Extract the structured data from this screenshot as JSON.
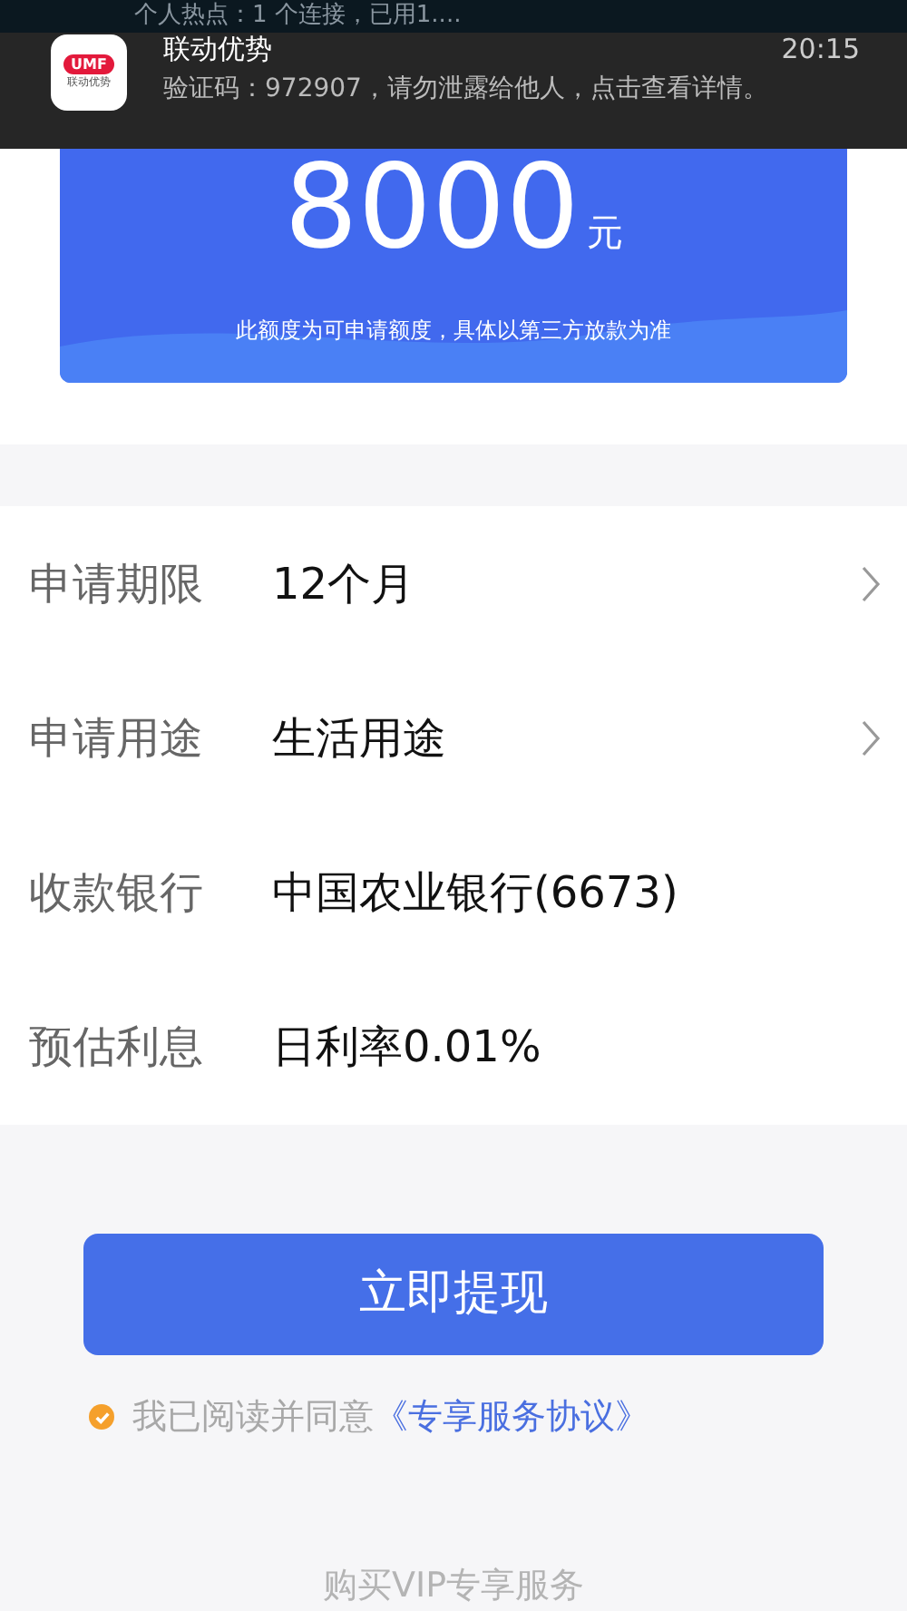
{
  "status_bar": {
    "hotspot": "个人热点：1 个连接，已用1...."
  },
  "notification": {
    "app_logo": "UMF",
    "app_logo_caption": "联动优势",
    "app": "联动优势",
    "time": "20:15",
    "message": "验证码：972907，请勿泄露给他人，点击查看详情。"
  },
  "amount_card": {
    "amount": "8000",
    "unit": "元",
    "note": "此额度为可申请额度，具体以第三方放款为准"
  },
  "fields": [
    {
      "label": "申请期限",
      "value": "12个月",
      "kind": "select"
    },
    {
      "label": "申请用途",
      "value": "生活用途",
      "kind": "select"
    },
    {
      "label": "收款银行",
      "value": "中国农业银行(6673)",
      "kind": "info"
    },
    {
      "label": "预估利息",
      "value": "日利率0.01%",
      "kind": "info"
    }
  ],
  "submit_button": "立即提现",
  "agreement": {
    "checked": true,
    "text": "我已阅读并同意",
    "link": "《专享服务协议》"
  },
  "footer_link": "购买VIP专享服务"
}
